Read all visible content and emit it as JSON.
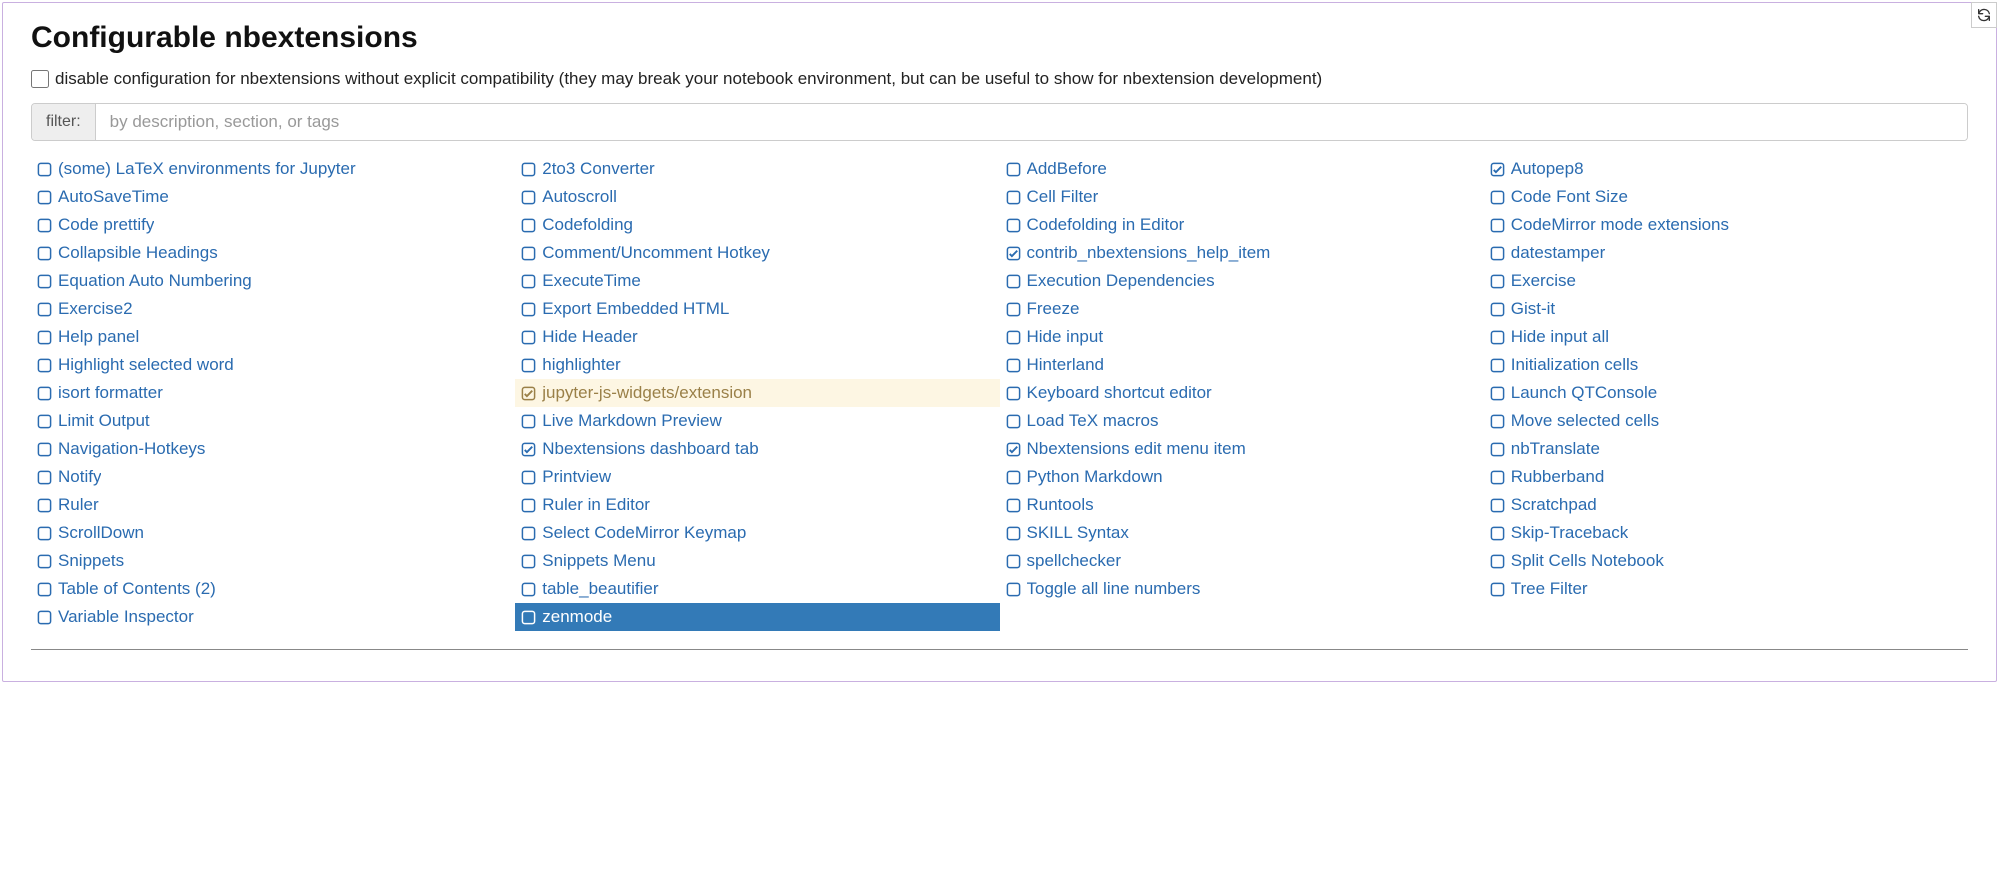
{
  "title": "Configurable nbextensions",
  "compat_checkbox": {
    "checked": false,
    "label": "disable configuration for nbextensions without explicit compatibility (they may break your notebook environment, but can be useful to show for nbextension development)"
  },
  "filter": {
    "label": "filter:",
    "placeholder": "by description, section, or tags",
    "value": ""
  },
  "extensions": [
    {
      "label": "(some) LaTeX environments for Jupyter",
      "checked": false,
      "disabled": false,
      "selected": false
    },
    {
      "label": "2to3 Converter",
      "checked": false,
      "disabled": false,
      "selected": false
    },
    {
      "label": "AddBefore",
      "checked": false,
      "disabled": false,
      "selected": false
    },
    {
      "label": "Autopep8",
      "checked": true,
      "disabled": false,
      "selected": false
    },
    {
      "label": "AutoSaveTime",
      "checked": false,
      "disabled": false,
      "selected": false
    },
    {
      "label": "Autoscroll",
      "checked": false,
      "disabled": false,
      "selected": false
    },
    {
      "label": "Cell Filter",
      "checked": false,
      "disabled": false,
      "selected": false
    },
    {
      "label": "Code Font Size",
      "checked": false,
      "disabled": false,
      "selected": false
    },
    {
      "label": "Code prettify",
      "checked": false,
      "disabled": false,
      "selected": false
    },
    {
      "label": "Codefolding",
      "checked": false,
      "disabled": false,
      "selected": false
    },
    {
      "label": "Codefolding in Editor",
      "checked": false,
      "disabled": false,
      "selected": false
    },
    {
      "label": "CodeMirror mode extensions",
      "checked": false,
      "disabled": false,
      "selected": false
    },
    {
      "label": "Collapsible Headings",
      "checked": false,
      "disabled": false,
      "selected": false
    },
    {
      "label": "Comment/Uncomment Hotkey",
      "checked": false,
      "disabled": false,
      "selected": false
    },
    {
      "label": "contrib_nbextensions_help_item",
      "checked": true,
      "disabled": false,
      "selected": false
    },
    {
      "label": "datestamper",
      "checked": false,
      "disabled": false,
      "selected": false
    },
    {
      "label": "Equation Auto Numbering",
      "checked": false,
      "disabled": false,
      "selected": false
    },
    {
      "label": "ExecuteTime",
      "checked": false,
      "disabled": false,
      "selected": false
    },
    {
      "label": "Execution Dependencies",
      "checked": false,
      "disabled": false,
      "selected": false
    },
    {
      "label": "Exercise",
      "checked": false,
      "disabled": false,
      "selected": false
    },
    {
      "label": "Exercise2",
      "checked": false,
      "disabled": false,
      "selected": false
    },
    {
      "label": "Export Embedded HTML",
      "checked": false,
      "disabled": false,
      "selected": false
    },
    {
      "label": "Freeze",
      "checked": false,
      "disabled": false,
      "selected": false
    },
    {
      "label": "Gist-it",
      "checked": false,
      "disabled": false,
      "selected": false
    },
    {
      "label": "Help panel",
      "checked": false,
      "disabled": false,
      "selected": false
    },
    {
      "label": "Hide Header",
      "checked": false,
      "disabled": false,
      "selected": false
    },
    {
      "label": "Hide input",
      "checked": false,
      "disabled": false,
      "selected": false
    },
    {
      "label": "Hide input all",
      "checked": false,
      "disabled": false,
      "selected": false
    },
    {
      "label": "Highlight selected word",
      "checked": false,
      "disabled": false,
      "selected": false
    },
    {
      "label": "highlighter",
      "checked": false,
      "disabled": false,
      "selected": false
    },
    {
      "label": "Hinterland",
      "checked": false,
      "disabled": false,
      "selected": false
    },
    {
      "label": "Initialization cells",
      "checked": false,
      "disabled": false,
      "selected": false
    },
    {
      "label": "isort formatter",
      "checked": false,
      "disabled": false,
      "selected": false
    },
    {
      "label": "jupyter-js-widgets/extension",
      "checked": true,
      "disabled": true,
      "selected": false
    },
    {
      "label": "Keyboard shortcut editor",
      "checked": false,
      "disabled": false,
      "selected": false
    },
    {
      "label": "Launch QTConsole",
      "checked": false,
      "disabled": false,
      "selected": false
    },
    {
      "label": "Limit Output",
      "checked": false,
      "disabled": false,
      "selected": false
    },
    {
      "label": "Live Markdown Preview",
      "checked": false,
      "disabled": false,
      "selected": false
    },
    {
      "label": "Load TeX macros",
      "checked": false,
      "disabled": false,
      "selected": false
    },
    {
      "label": "Move selected cells",
      "checked": false,
      "disabled": false,
      "selected": false
    },
    {
      "label": "Navigation-Hotkeys",
      "checked": false,
      "disabled": false,
      "selected": false
    },
    {
      "label": "Nbextensions dashboard tab",
      "checked": true,
      "disabled": false,
      "selected": false
    },
    {
      "label": "Nbextensions edit menu item",
      "checked": true,
      "disabled": false,
      "selected": false
    },
    {
      "label": "nbTranslate",
      "checked": false,
      "disabled": false,
      "selected": false
    },
    {
      "label": "Notify",
      "checked": false,
      "disabled": false,
      "selected": false
    },
    {
      "label": "Printview",
      "checked": false,
      "disabled": false,
      "selected": false
    },
    {
      "label": "Python Markdown",
      "checked": false,
      "disabled": false,
      "selected": false
    },
    {
      "label": "Rubberband",
      "checked": false,
      "disabled": false,
      "selected": false
    },
    {
      "label": "Ruler",
      "checked": false,
      "disabled": false,
      "selected": false
    },
    {
      "label": "Ruler in Editor",
      "checked": false,
      "disabled": false,
      "selected": false
    },
    {
      "label": "Runtools",
      "checked": false,
      "disabled": false,
      "selected": false
    },
    {
      "label": "Scratchpad",
      "checked": false,
      "disabled": false,
      "selected": false
    },
    {
      "label": "ScrollDown",
      "checked": false,
      "disabled": false,
      "selected": false
    },
    {
      "label": "Select CodeMirror Keymap",
      "checked": false,
      "disabled": false,
      "selected": false
    },
    {
      "label": "SKILL Syntax",
      "checked": false,
      "disabled": false,
      "selected": false
    },
    {
      "label": "Skip-Traceback",
      "checked": false,
      "disabled": false,
      "selected": false
    },
    {
      "label": "Snippets",
      "checked": false,
      "disabled": false,
      "selected": false
    },
    {
      "label": "Snippets Menu",
      "checked": false,
      "disabled": false,
      "selected": false
    },
    {
      "label": "spellchecker",
      "checked": false,
      "disabled": false,
      "selected": false
    },
    {
      "label": "Split Cells Notebook",
      "checked": false,
      "disabled": false,
      "selected": false
    },
    {
      "label": "Table of Contents (2)",
      "checked": false,
      "disabled": false,
      "selected": false
    },
    {
      "label": "table_beautifier",
      "checked": false,
      "disabled": false,
      "selected": false
    },
    {
      "label": "Toggle all line numbers",
      "checked": false,
      "disabled": false,
      "selected": false
    },
    {
      "label": "Tree Filter",
      "checked": false,
      "disabled": false,
      "selected": false
    },
    {
      "label": "Variable Inspector",
      "checked": false,
      "disabled": false,
      "selected": false
    },
    {
      "label": "zenmode",
      "checked": false,
      "disabled": false,
      "selected": true
    }
  ]
}
